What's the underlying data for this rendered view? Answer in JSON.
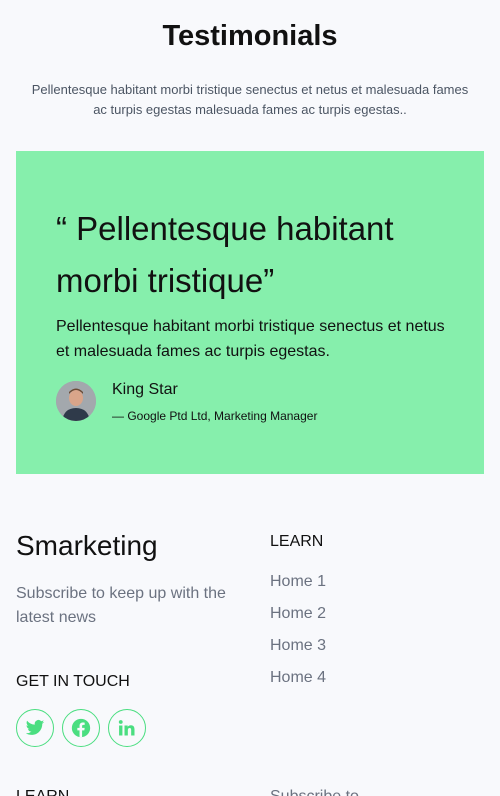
{
  "testimonials": {
    "title": "Testimonials",
    "intro": "Pellentesque habitant morbi tristique senectus et netus et malesuada fames ac turpis egestas malesuada fames ac turpis egestas..",
    "card": {
      "quote": "“ Pellentesque habitant morbi tristique”",
      "body": "Pellentesque habitant morbi tristique senectus et netus et malesuada fames ac turpis egestas.",
      "author_name": "King Star",
      "author_role": "— Google Ptd Ltd, Marketing Manager"
    }
  },
  "footer": {
    "brand": "Smarketing",
    "subscribe_text": "Subscribe to keep up with the latest news",
    "get_in_touch": "GET IN TOUCH",
    "social_icons": [
      "twitter-icon",
      "facebook-icon",
      "linkedin-icon"
    ],
    "learn": {
      "title": "LEARN",
      "links": [
        "Home 1",
        "Home 2",
        "Home 3",
        "Home 4"
      ]
    },
    "bottom_learn_title": "LEARN",
    "bottom_subscribe_label": "Subscribe to"
  },
  "colors": {
    "background": "#f8f9fc",
    "card_background": "#86efac",
    "accent_green": "#4ade80",
    "muted_text": "#6b7280"
  }
}
